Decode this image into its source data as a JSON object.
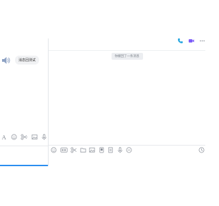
{
  "left_chat": {
    "message_text": "消息回测试"
  },
  "right_chat": {
    "system_notice": "你撤回了一条消息"
  },
  "colors": {
    "accent": "#2b8ef0",
    "phone_icon": "#2ca9e1",
    "video_icon": "#7a5af8"
  },
  "icons": {
    "header": [
      "phone-icon",
      "video-icon",
      "more-icon"
    ],
    "left_toolbar": [
      "font-icon",
      "emoji-icon",
      "scissors-icon",
      "image-icon",
      "microphone-icon"
    ],
    "right_toolbar": [
      "emoji-icon",
      "gif-icon",
      "scissors-icon",
      "folder-icon",
      "image-icon",
      "screen-icon",
      "file-icon",
      "microphone-icon",
      "more-circle-icon"
    ],
    "right_extra": "history-icon"
  }
}
